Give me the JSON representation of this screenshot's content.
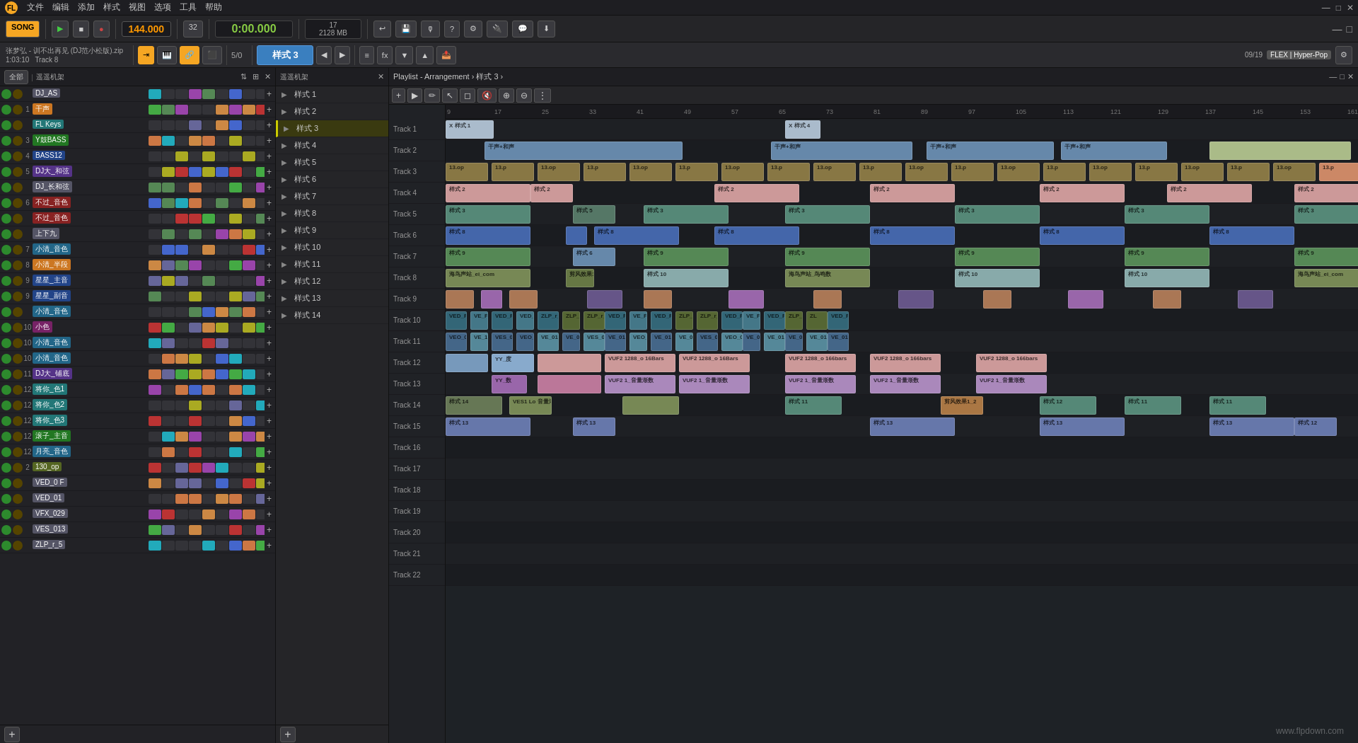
{
  "app": {
    "title": "FL Studio",
    "watermark": "www.flpdown.com"
  },
  "menubar": {
    "items": [
      "文件",
      "编辑",
      "添加",
      "样式",
      "视图",
      "选项",
      "工具",
      "帮助"
    ]
  },
  "transport": {
    "song_label": "SONG",
    "play_btn": "▶",
    "stop_btn": "■",
    "record_btn": "●",
    "bpm": "144.000",
    "time": "0:00.000",
    "cpu_label": "17",
    "memory_label": "2128 MB",
    "pattern_btn": "样式 3",
    "step_count": "32",
    "time_sig": "5/0"
  },
  "toolbar2": {
    "file_info": "张梦弘 - 训不出再见 (DJ范小松版).zip",
    "time_info": "1:03:10",
    "track_info": "Track 8",
    "pattern_name": "样式 3",
    "flex_badge": "FLEX | Hyper-Pop",
    "slot_info": "09/19"
  },
  "channel_strip": {
    "header_labels": [
      "全部",
      "遥遥机架"
    ],
    "channels": [
      {
        "num": "",
        "name": "DJ_AS",
        "color": "grey",
        "active": true
      },
      {
        "num": "1",
        "name": "干声",
        "color": "orange",
        "active": true
      },
      {
        "num": "",
        "name": "FL Keys",
        "color": "teal",
        "active": true
      },
      {
        "num": "3",
        "name": "Y鼓BASS",
        "color": "green",
        "active": true
      },
      {
        "num": "4",
        "name": "BASS12",
        "color": "blue",
        "active": true
      },
      {
        "num": "5",
        "name": "DJ大_和弦",
        "color": "purple",
        "active": true
      },
      {
        "num": "",
        "name": "DJ_长和弦",
        "color": "grey",
        "active": true
      },
      {
        "num": "6",
        "name": "不过_音色",
        "color": "red",
        "active": true
      },
      {
        "num": "",
        "name": "不过_音色",
        "color": "red",
        "active": true
      },
      {
        "num": "",
        "name": "上下九",
        "color": "grey",
        "active": true
      },
      {
        "num": "7",
        "name": "小清_音色",
        "color": "cyan",
        "active": true
      },
      {
        "num": "8",
        "name": "小清_半段",
        "color": "orange",
        "active": true
      },
      {
        "num": "9",
        "name": "星星_主音",
        "color": "blue",
        "active": true
      },
      {
        "num": "9",
        "name": "星星_副音",
        "color": "blue",
        "active": true
      },
      {
        "num": "",
        "name": "小清_音色",
        "color": "cyan",
        "active": true
      },
      {
        "num": "10",
        "name": "小色",
        "color": "magenta",
        "active": true
      },
      {
        "num": "10",
        "name": "小清_音色",
        "color": "cyan",
        "active": true
      },
      {
        "num": "10",
        "name": "小清_音色",
        "color": "cyan",
        "active": true
      },
      {
        "num": "11",
        "name": "DJ大_铺底",
        "color": "purple",
        "active": true
      },
      {
        "num": "12",
        "name": "将你_色1",
        "color": "teal",
        "active": true
      },
      {
        "num": "12",
        "name": "将你_色2",
        "color": "teal",
        "active": true
      },
      {
        "num": "12",
        "name": "将你_色3",
        "color": "teal",
        "active": true
      },
      {
        "num": "12",
        "name": "滚子_主音",
        "color": "green",
        "active": true
      },
      {
        "num": "12",
        "name": "月亮_音色",
        "color": "cyan",
        "active": true
      },
      {
        "num": "2",
        "name": "130_op",
        "color": "olive",
        "active": true
      },
      {
        "num": "",
        "name": "VED_0 F",
        "color": "grey",
        "active": true
      },
      {
        "num": "",
        "name": "VED_01",
        "color": "grey",
        "active": true
      },
      {
        "num": "",
        "name": "VFX_029",
        "color": "grey",
        "active": true
      },
      {
        "num": "",
        "name": "VES_013",
        "color": "grey",
        "active": true
      },
      {
        "num": "",
        "name": "ZLP_r_5",
        "color": "grey",
        "active": true
      }
    ]
  },
  "pattern_panel": {
    "title": "遥遥机架",
    "patterns": [
      {
        "label": "样式 1",
        "active": false
      },
      {
        "label": "样式 2",
        "active": false
      },
      {
        "label": "样式 3",
        "active": true
      },
      {
        "label": "样式 4",
        "active": false
      },
      {
        "label": "样式 5",
        "active": false
      },
      {
        "label": "样式 6",
        "active": false
      },
      {
        "label": "样式 7",
        "active": false
      },
      {
        "label": "样式 8",
        "active": false
      },
      {
        "label": "样式 9",
        "active": false
      },
      {
        "label": "样式 10",
        "active": false
      },
      {
        "label": "样式 11",
        "active": false
      },
      {
        "label": "样式 12",
        "active": false
      },
      {
        "label": "样式 13",
        "active": false
      },
      {
        "label": "样式 14",
        "active": false
      }
    ]
  },
  "playlist": {
    "title": "Playlist - Arrangement › 样式 3 ›",
    "ruler_marks": [
      "9",
      "17",
      "25",
      "33",
      "41",
      "49",
      "57",
      "65",
      "73",
      "81",
      "89",
      "97",
      "105",
      "113",
      "121",
      "129",
      "137",
      "145",
      "153",
      "161"
    ],
    "tracks": [
      {
        "label": "Track 1"
      },
      {
        "label": "Track 2"
      },
      {
        "label": "Track 3"
      },
      {
        "label": "Track 4"
      },
      {
        "label": "Track 5"
      },
      {
        "label": "Track 6"
      },
      {
        "label": "Track 7"
      },
      {
        "label": "Track 8"
      },
      {
        "label": "Track 9"
      },
      {
        "label": "Track 10"
      },
      {
        "label": "Track 11"
      },
      {
        "label": "Track 12"
      },
      {
        "label": "Track 13"
      },
      {
        "label": "Track 14"
      },
      {
        "label": "Track 15"
      },
      {
        "label": "Track 16"
      },
      {
        "label": "Track 17"
      },
      {
        "label": "Track 18"
      },
      {
        "label": "Track 19"
      },
      {
        "label": "Track 20"
      },
      {
        "label": "Track 21"
      },
      {
        "label": "Track 22"
      }
    ],
    "blocks_description": "Various colored pattern blocks across tracks"
  }
}
